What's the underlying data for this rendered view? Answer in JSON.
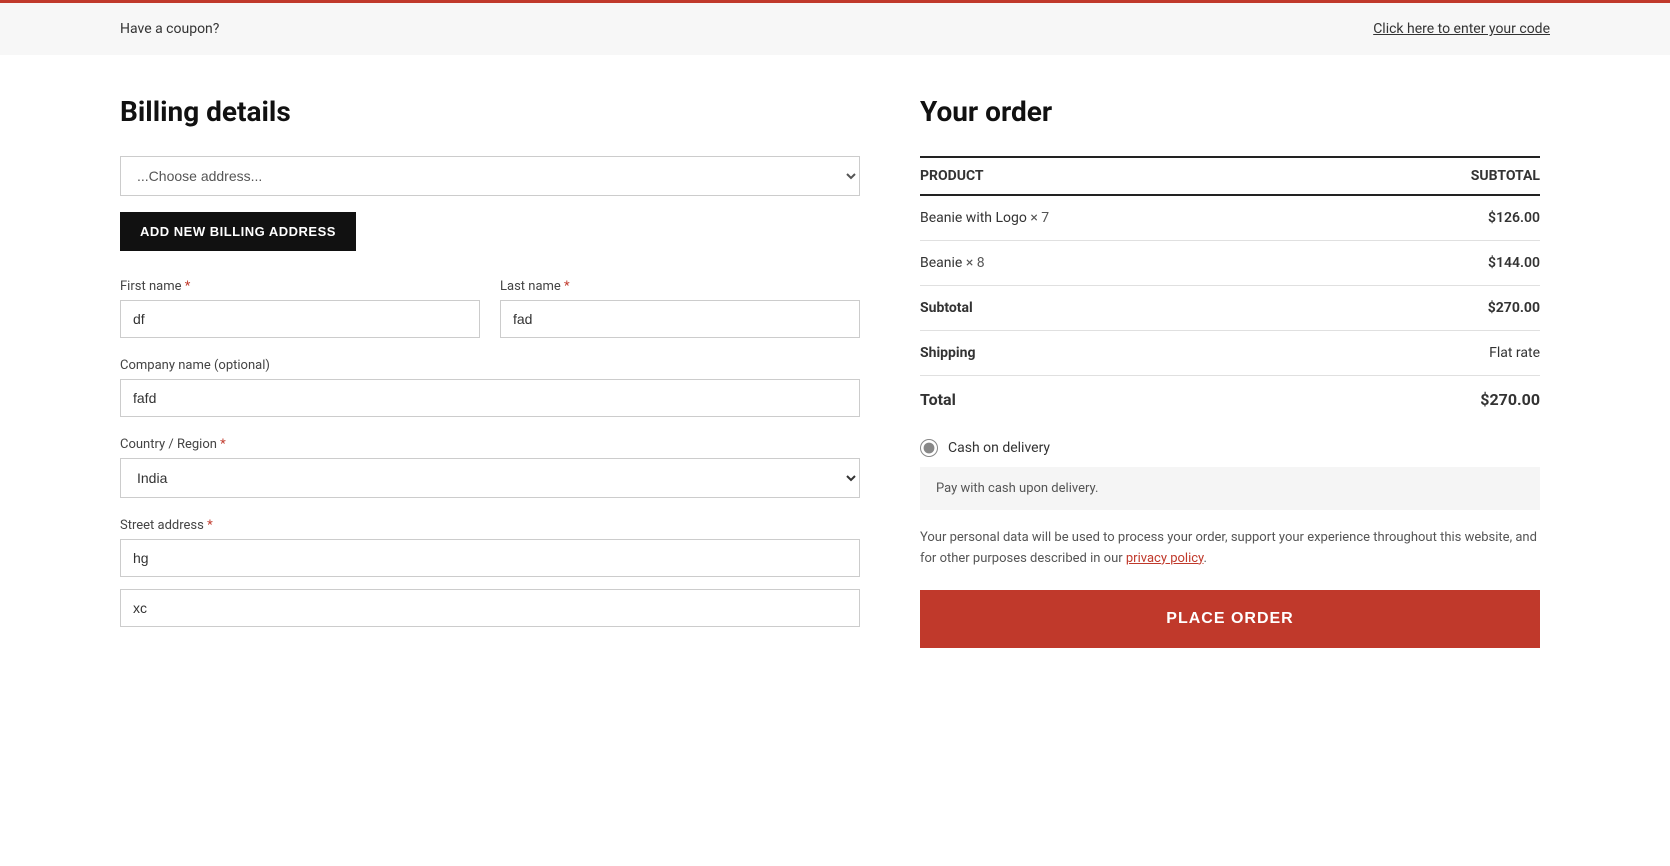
{
  "coupon": {
    "text": "Have a coupon?",
    "link_label": "Click here to enter your code"
  },
  "billing": {
    "title": "Billing details",
    "address_select_placeholder": "...Choose address...",
    "add_address_btn": "ADD NEW BILLING ADDRESS",
    "first_name_label": "First name",
    "first_name_required": "*",
    "first_name_value": "df",
    "last_name_label": "Last name",
    "last_name_required": "*",
    "last_name_value": "fad",
    "company_label": "Company name (optional)",
    "company_value": "fafd",
    "country_label": "Country / Region",
    "country_required": "*",
    "country_value": "India",
    "street_label": "Street address",
    "street_required": "*",
    "street_value_1": "hg",
    "street_value_2": "xc"
  },
  "order": {
    "title": "Your order",
    "col_product": "PRODUCT",
    "col_subtotal": "SUBTOTAL",
    "items": [
      {
        "name": "Beanie with Logo",
        "quantity": "× 7",
        "price": "$126.00"
      },
      {
        "name": "Beanie",
        "quantity": "× 8",
        "price": "$144.00"
      }
    ],
    "subtotal_label": "Subtotal",
    "subtotal_value": "$270.00",
    "shipping_label": "Shipping",
    "shipping_value": "Flat rate",
    "total_label": "Total",
    "total_value": "$270.00",
    "payment_method_label": "Cash on delivery",
    "payment_description": "Pay with cash upon delivery.",
    "privacy_text_1": "Your personal data will be used to process your order, support your experience throughout this website, and for other purposes described in our ",
    "privacy_link": "privacy policy",
    "privacy_text_2": ".",
    "place_order_btn": "PLACE ORDER"
  }
}
